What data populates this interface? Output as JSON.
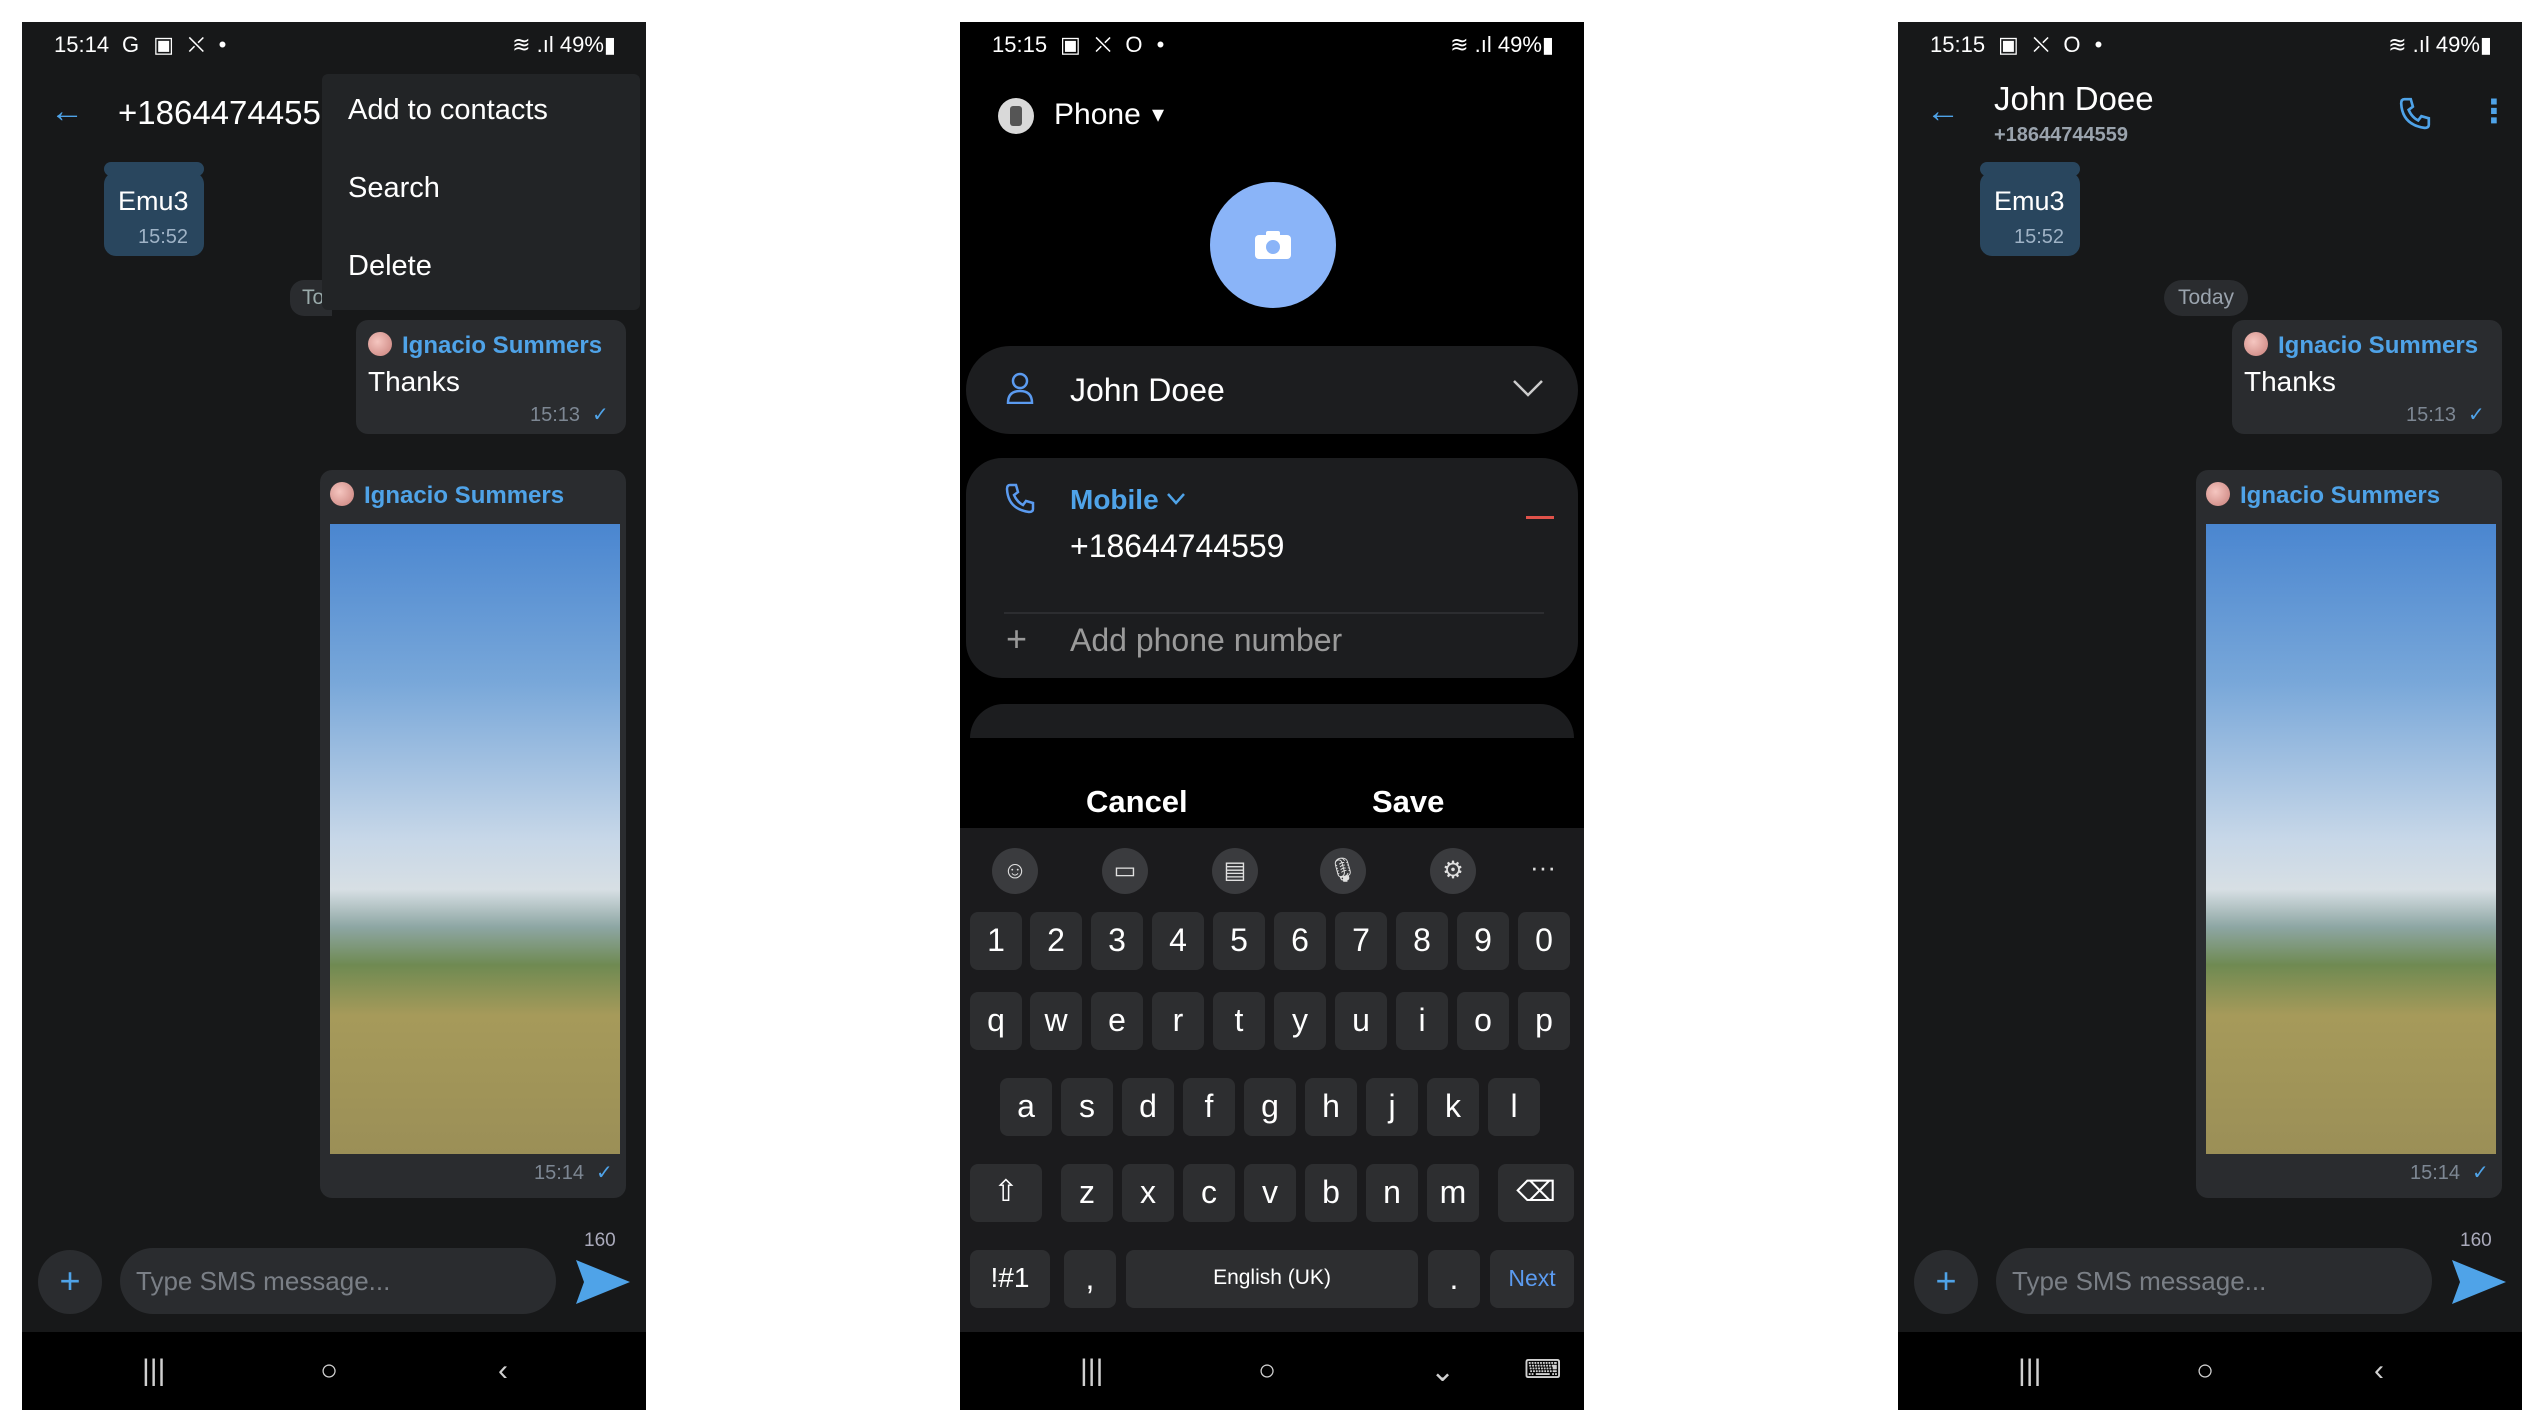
{
  "left": {
    "status": {
      "time": "15:14",
      "icons": "G ▣ ⛌ •",
      "right": "≋ .ıl 49%▮"
    },
    "header": {
      "back": "←",
      "number": "+1864474455"
    },
    "menu": [
      "Add to contacts",
      "Search",
      "Delete"
    ],
    "date_chip": "To",
    "msg1": {
      "text": "Emu3",
      "time": "15:52"
    },
    "msg2": {
      "sender": "Ignacio Summers",
      "text": "Thanks",
      "time": "15:13"
    },
    "msg3": {
      "sender": "Ignacio Summers",
      "time": "15:14"
    },
    "composer": {
      "placeholder": "Type SMS message...",
      "counter": "160"
    },
    "nav": [
      "|||",
      "○",
      "‹"
    ]
  },
  "middle": {
    "status": {
      "time": "15:15",
      "icons": "▣ ⛌ O •",
      "right": "≋ .ıl 49%▮"
    },
    "account": {
      "label": "Phone",
      "caret": "▾"
    },
    "name_value": "John Doee",
    "phone_type": "Mobile",
    "phone_number": "+18644744559",
    "add_phone": "Add phone number",
    "actions": {
      "cancel": "Cancel",
      "save": "Save"
    },
    "keyboard": {
      "numbers": [
        "1",
        "2",
        "3",
        "4",
        "5",
        "6",
        "7",
        "8",
        "9",
        "0"
      ],
      "row1": [
        "q",
        "w",
        "e",
        "r",
        "t",
        "y",
        "u",
        "i",
        "o",
        "p"
      ],
      "row2": [
        "a",
        "s",
        "d",
        "f",
        "g",
        "h",
        "j",
        "k",
        "l"
      ],
      "row3": [
        "z",
        "x",
        "c",
        "v",
        "b",
        "n",
        "m"
      ],
      "sym": "!#1",
      "comma": ",",
      "space": "English (UK)",
      "period": ".",
      "next": "Next"
    },
    "nav": [
      "|||",
      "○",
      "⌄",
      "⌨"
    ]
  },
  "right": {
    "status": {
      "time": "15:15",
      "icons": "▣ ⛌ O •",
      "right": "≋ .ıl 49%▮"
    },
    "header": {
      "back": "←",
      "name": "John Doee",
      "number": "+18644744559"
    },
    "date_chip": "Today",
    "msg1": {
      "text": "Emu3",
      "time": "15:52"
    },
    "msg2": {
      "sender": "Ignacio Summers",
      "text": "Thanks",
      "time": "15:13"
    },
    "msg3": {
      "sender": "Ignacio Summers",
      "time": "15:14"
    },
    "composer": {
      "placeholder": "Type SMS message...",
      "counter": "160"
    },
    "nav": [
      "|||",
      "○",
      "‹"
    ]
  },
  "colors": {
    "accent": "#4fa3e8",
    "incoming_bubble": "#29465e",
    "outgoing_bubble": "#2a2c2f",
    "app_bg": "#171819",
    "avatar_blue": "#8ab4f8",
    "delete_red": "#e0524a"
  }
}
